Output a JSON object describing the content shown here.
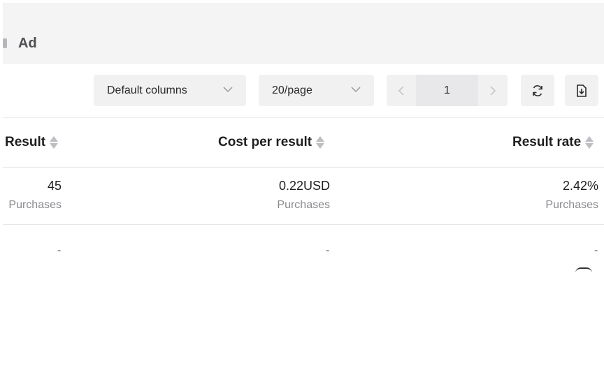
{
  "tab": {
    "label": "Ad"
  },
  "toolbar": {
    "columns_select": "Default columns",
    "page_size_select": "20/page",
    "current_page": "1"
  },
  "table": {
    "headers": [
      "Result",
      "Cost per result",
      "Result rate"
    ],
    "rows": [
      {
        "result": "45",
        "result_sub": "Purchases",
        "cost": "0.22USD",
        "cost_sub": "Purchases",
        "rate": "2.42%",
        "rate_sub": "Purchases"
      },
      {
        "result": "-",
        "cost": "-",
        "rate": "-"
      }
    ]
  },
  "icons": {
    "refresh": "refresh-icon",
    "export": "export-download-icon",
    "prev": "chevron-left-icon",
    "next": "chevron-right-icon",
    "dropdown": "chevron-down-icon"
  },
  "colors": {
    "toolbar_bg": "#f1f1f2",
    "muted_text": "#8a8a8f",
    "header_bg": "#f4f4f5"
  }
}
